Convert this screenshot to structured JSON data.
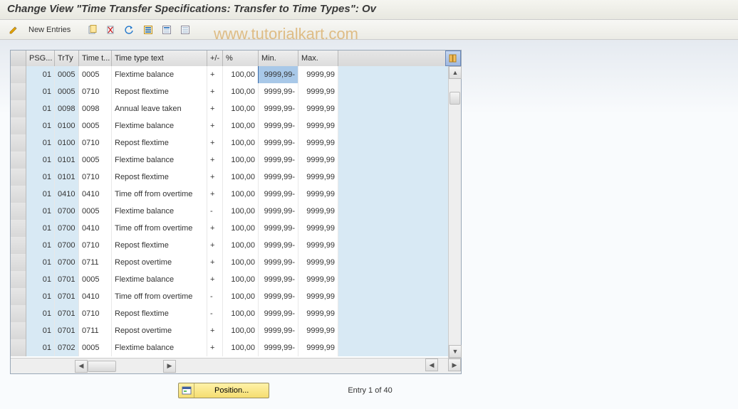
{
  "header": {
    "title": "Change View \"Time Transfer Specifications: Transfer to Time Types\": Ov"
  },
  "toolbar": {
    "new_entries_label": "New Entries"
  },
  "watermark": "www.tutorialkart.com",
  "table": {
    "headers": {
      "psg": "PSG...",
      "trty": "TrTy",
      "tt": "Time t...",
      "text": "Time type text",
      "pm": "+/-",
      "pct": "%",
      "min": "Min.",
      "max": "Max."
    },
    "rows": [
      {
        "psg": "01",
        "trty": "0005",
        "tt": "0005",
        "text": "Flextime balance",
        "pm": "+",
        "pct": "100,00",
        "min": "9999,99-",
        "max": "9999,99"
      },
      {
        "psg": "01",
        "trty": "0005",
        "tt": "0710",
        "text": "Repost flextime",
        "pm": "+",
        "pct": "100,00",
        "min": "9999,99-",
        "max": "9999,99"
      },
      {
        "psg": "01",
        "trty": "0098",
        "tt": "0098",
        "text": "Annual leave taken",
        "pm": "+",
        "pct": "100,00",
        "min": "9999,99-",
        "max": "9999,99"
      },
      {
        "psg": "01",
        "trty": "0100",
        "tt": "0005",
        "text": "Flextime balance",
        "pm": "+",
        "pct": "100,00",
        "min": "9999,99-",
        "max": "9999,99"
      },
      {
        "psg": "01",
        "trty": "0100",
        "tt": "0710",
        "text": "Repost flextime",
        "pm": "+",
        "pct": "100,00",
        "min": "9999,99-",
        "max": "9999,99"
      },
      {
        "psg": "01",
        "trty": "0101",
        "tt": "0005",
        "text": "Flextime balance",
        "pm": "+",
        "pct": "100,00",
        "min": "9999,99-",
        "max": "9999,99"
      },
      {
        "psg": "01",
        "trty": "0101",
        "tt": "0710",
        "text": "Repost flextime",
        "pm": "+",
        "pct": "100,00",
        "min": "9999,99-",
        "max": "9999,99"
      },
      {
        "psg": "01",
        "trty": "0410",
        "tt": "0410",
        "text": "Time off from overtime",
        "pm": "+",
        "pct": "100,00",
        "min": "9999,99-",
        "max": "9999,99"
      },
      {
        "psg": "01",
        "trty": "0700",
        "tt": "0005",
        "text": "Flextime balance",
        "pm": "-",
        "pct": "100,00",
        "min": "9999,99-",
        "max": "9999,99"
      },
      {
        "psg": "01",
        "trty": "0700",
        "tt": "0410",
        "text": "Time off from overtime",
        "pm": "+",
        "pct": "100,00",
        "min": "9999,99-",
        "max": "9999,99"
      },
      {
        "psg": "01",
        "trty": "0700",
        "tt": "0710",
        "text": "Repost flextime",
        "pm": "+",
        "pct": "100,00",
        "min": "9999,99-",
        "max": "9999,99"
      },
      {
        "psg": "01",
        "trty": "0700",
        "tt": "0711",
        "text": "Repost overtime",
        "pm": "+",
        "pct": "100,00",
        "min": "9999,99-",
        "max": "9999,99"
      },
      {
        "psg": "01",
        "trty": "0701",
        "tt": "0005",
        "text": "Flextime balance",
        "pm": "+",
        "pct": "100,00",
        "min": "9999,99-",
        "max": "9999,99"
      },
      {
        "psg": "01",
        "trty": "0701",
        "tt": "0410",
        "text": "Time off from overtime",
        "pm": "-",
        "pct": "100,00",
        "min": "9999,99-",
        "max": "9999,99"
      },
      {
        "psg": "01",
        "trty": "0701",
        "tt": "0710",
        "text": "Repost flextime",
        "pm": "-",
        "pct": "100,00",
        "min": "9999,99-",
        "max": "9999,99"
      },
      {
        "psg": "01",
        "trty": "0701",
        "tt": "0711",
        "text": "Repost overtime",
        "pm": "+",
        "pct": "100,00",
        "min": "9999,99-",
        "max": "9999,99"
      },
      {
        "psg": "01",
        "trty": "0702",
        "tt": "0005",
        "text": "Flextime balance",
        "pm": "+",
        "pct": "100,00",
        "min": "9999,99-",
        "max": "9999,99"
      }
    ]
  },
  "footer": {
    "position_label": "Position...",
    "entry_text": "Entry 1 of 40"
  }
}
